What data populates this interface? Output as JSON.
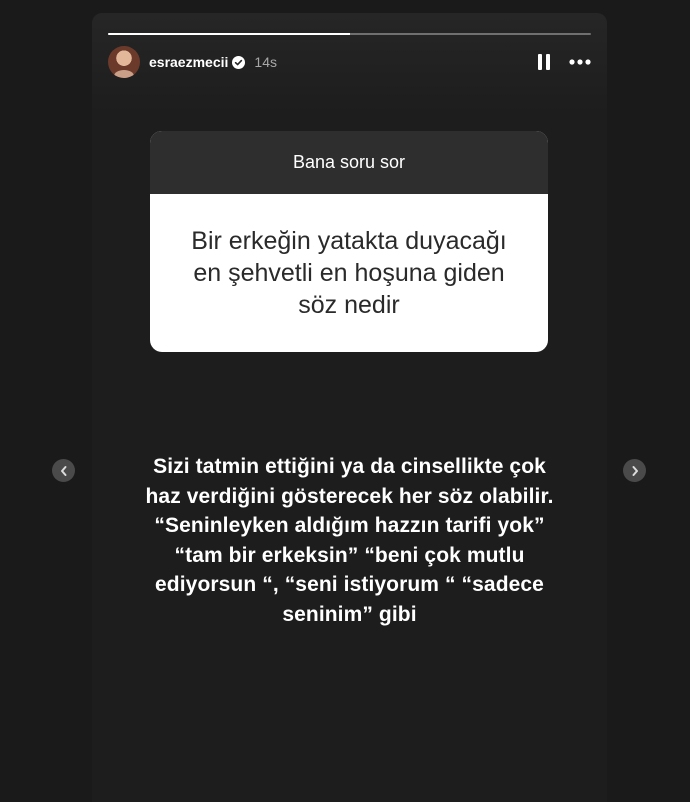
{
  "story": {
    "progress_fraction": 0.5,
    "username": "esraezmecii",
    "timestamp": "14s",
    "verified": true,
    "icons": {
      "pause": "pause-icon",
      "more": "more-options-icon",
      "verified": "verified-badge-icon",
      "prev": "chevron-left-icon",
      "next": "chevron-right-icon"
    }
  },
  "question_sticker": {
    "header": "Bana soru sor",
    "question_lines": [
      "Bir erkeğin yatakta duyacağı",
      "en şehvetli en hoşuna giden",
      "söz nedir"
    ]
  },
  "answer": {
    "lines": [
      "Sizi tatmin ettiğini ya da cinsellikte çok",
      "haz verdiğini gösterecek her söz olabilir.",
      "“Seninleyken aldığım hazzın tarifi yok”",
      "“tam bir erkeksin” “beni çok mutlu",
      "ediyorsun “, “seni istiyorum “ “sadece",
      "seninim”  gibi"
    ]
  },
  "colors": {
    "background": "#1a1a1a",
    "card_header": "#2e2e2e",
    "card_body": "#ffffff",
    "text": "#ffffff"
  }
}
